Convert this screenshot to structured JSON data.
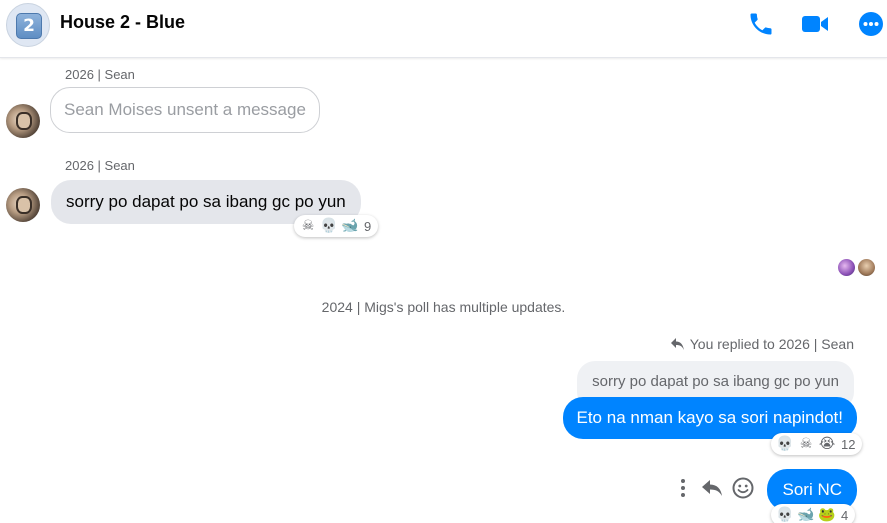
{
  "header": {
    "group_badge": "2",
    "title": "House 2 - Blue",
    "icons": [
      "phone-icon",
      "video-camera-icon",
      "more-options-icon"
    ]
  },
  "colors": {
    "accent": "#0084ff",
    "incoming_bubble": "#e4e6eb",
    "secondary_text": "#65676b"
  },
  "messages": [
    {
      "sender": "2026 | Sean",
      "text": "Sean Moises unsent a message",
      "type": "unsent"
    },
    {
      "sender": "2026 | Sean",
      "text": "sorry po dapat po sa ibang gc po yun",
      "type": "incoming",
      "reactions": {
        "emojis": [
          "☠",
          "💀",
          "🐋"
        ],
        "count": "9"
      }
    }
  ],
  "system_message": "2024 | Migs's poll has multiple updates.",
  "reply": {
    "note": "You replied to 2026 | Sean",
    "quoted_text": "sorry po dapat po sa ibang gc po yun",
    "text": "Eto na nman kayo sa sori napindot!",
    "reactions": {
      "emojis": [
        "💀",
        "☠",
        "😭"
      ],
      "count": "12"
    }
  },
  "last_message": {
    "text": "Sori NC",
    "reactions": {
      "emojis": [
        "💀",
        "🐋",
        "🐸"
      ],
      "count": "4"
    },
    "actions": [
      "more-icon",
      "reply-icon",
      "react-icon"
    ]
  }
}
